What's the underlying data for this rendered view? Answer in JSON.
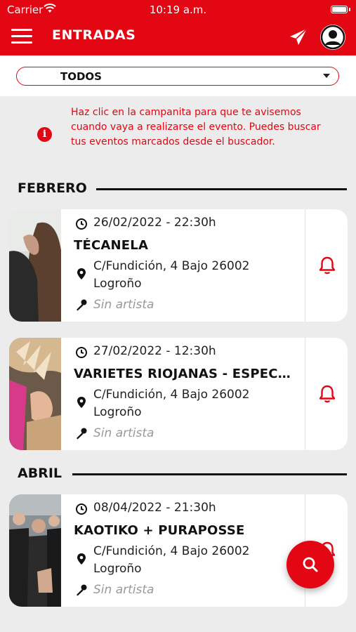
{
  "status": {
    "carrier": "Carrier",
    "time": "10:19 a.m."
  },
  "header": {
    "title": "ENTRADAS",
    "menu_icon": "hamburger-icon",
    "send_icon": "send-icon",
    "profile_icon": "user-icon"
  },
  "filter": {
    "value": "TODOS"
  },
  "notice": {
    "text": "Haz clic en la campanita para que te avisemos cuando vaya a realizarse el evento. Puedes buscar tus eventos marcados desde el buscador."
  },
  "months": [
    {
      "label": "FEBRERO",
      "events": [
        {
          "date": "26/02/2022 - 22:30h",
          "title": "TÉCANELA",
          "address_line1": "C/Fundición, 4 Bajo 26002",
          "address_line2": "Logroño",
          "artist": "Sin artista"
        },
        {
          "date": "27/02/2022 - 12:30h",
          "title": "VARIETES RIOJANAS - ESPECI...",
          "address_line1": "C/Fundición, 4 Bajo 26002",
          "address_line2": "Logroño",
          "artist": "Sin artista"
        }
      ]
    },
    {
      "label": "ABRIL",
      "events": [
        {
          "date": "08/04/2022 - 21:30h",
          "title": "KAOTIKO + PURAPOSSE",
          "address_line1": "C/Fundición, 4 Bajo 26002",
          "address_line2": "Logroño",
          "artist": "Sin artista"
        }
      ]
    }
  ],
  "colors": {
    "brand": "#e30613",
    "background": "#ececec"
  }
}
